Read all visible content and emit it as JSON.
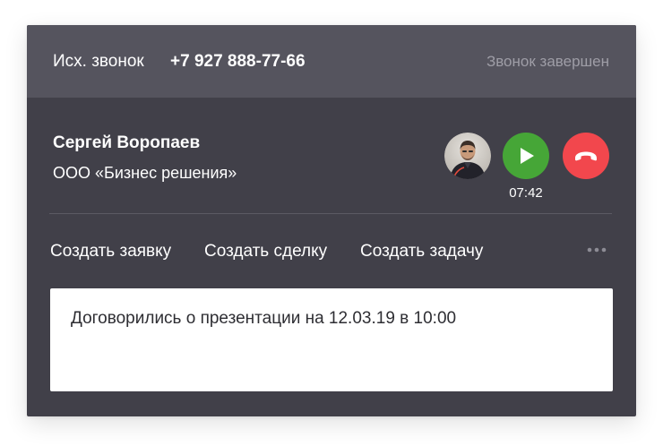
{
  "header": {
    "call_type": "Исх. звонок",
    "phone_number": "+7 927 888-77-66",
    "status": "Звонок завершен"
  },
  "contact": {
    "name": "Сергей Воропаев",
    "company": "ООО «Бизнес решения»"
  },
  "call_controls": {
    "timer": "07:42",
    "play_icon": "play-icon",
    "hangup_icon": "phone-hangup-icon",
    "play_color": "#46a637",
    "hangup_color": "#f2474d"
  },
  "actions": {
    "create_request": "Создать заявку",
    "create_deal": "Создать сделку",
    "create_task": "Создать задачу",
    "more_icon": "more-dots-icon"
  },
  "note": {
    "text": "Договорились о презентации на 12.03.19 в 10:00"
  }
}
